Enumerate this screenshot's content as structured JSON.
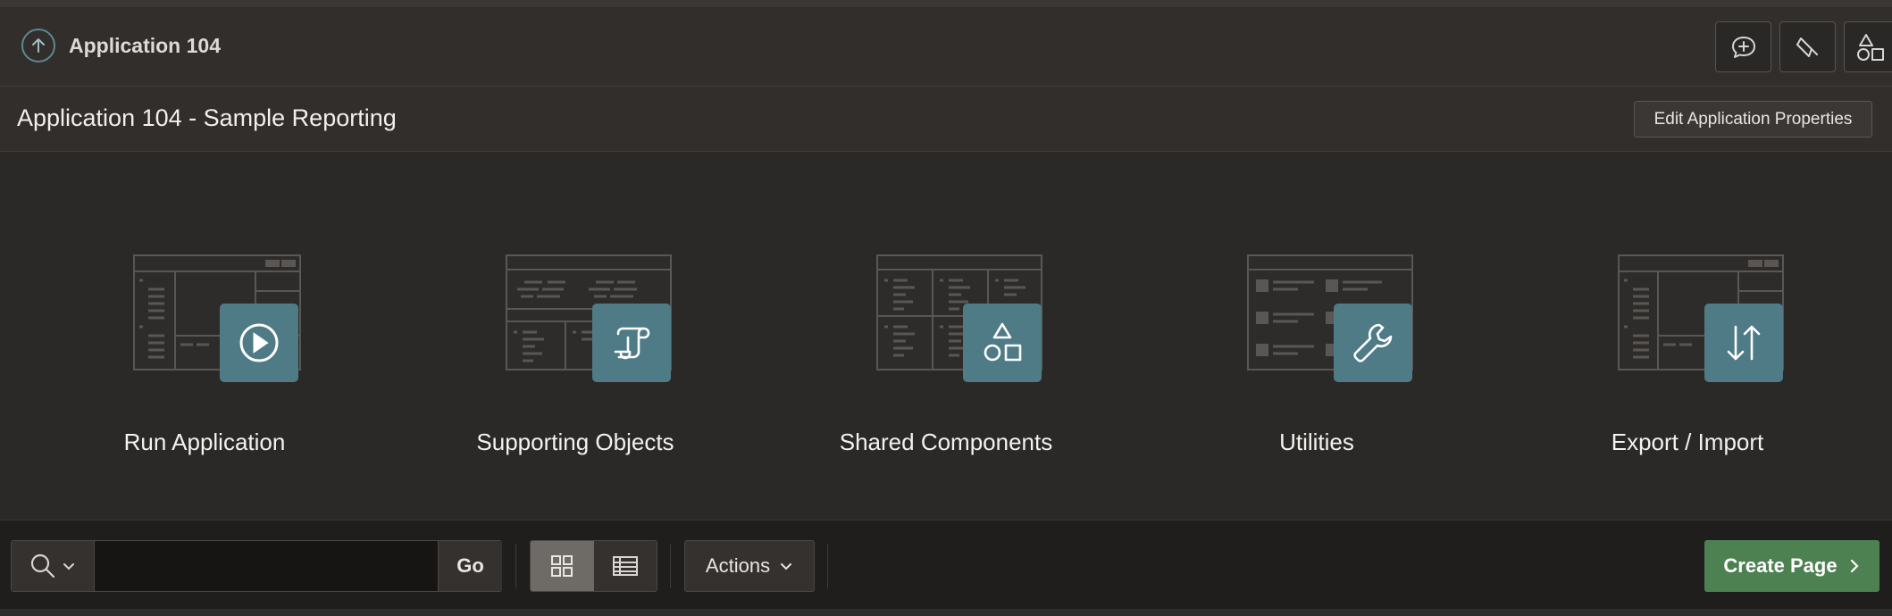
{
  "app_bar": {
    "title": "Application 104",
    "tools": [
      {
        "name": "feedback-icon"
      },
      {
        "name": "highlight-icon"
      },
      {
        "name": "shapes-icon"
      }
    ]
  },
  "header": {
    "title": "Application 104 - Sample Reporting",
    "edit_button": "Edit Application Properties"
  },
  "tiles": [
    {
      "label": "Run Application",
      "icon": "play-icon"
    },
    {
      "label": "Supporting Objects",
      "icon": "scroll-icon"
    },
    {
      "label": "Shared Components",
      "icon": "shapes-icon"
    },
    {
      "label": "Utilities",
      "icon": "wrench-icon"
    },
    {
      "label": "Export / Import",
      "icon": "transfer-arrows-icon"
    }
  ],
  "toolbar": {
    "search_placeholder": "",
    "go_label": "Go",
    "views": [
      "grid-view-icon",
      "report-view-icon"
    ],
    "active_view": "grid-view-icon",
    "actions_label": "Actions",
    "create_label": "Create Page"
  },
  "colors": {
    "accent_tile": "#4e7b86",
    "create_button": "#4d8152",
    "background": "#2b2927"
  }
}
